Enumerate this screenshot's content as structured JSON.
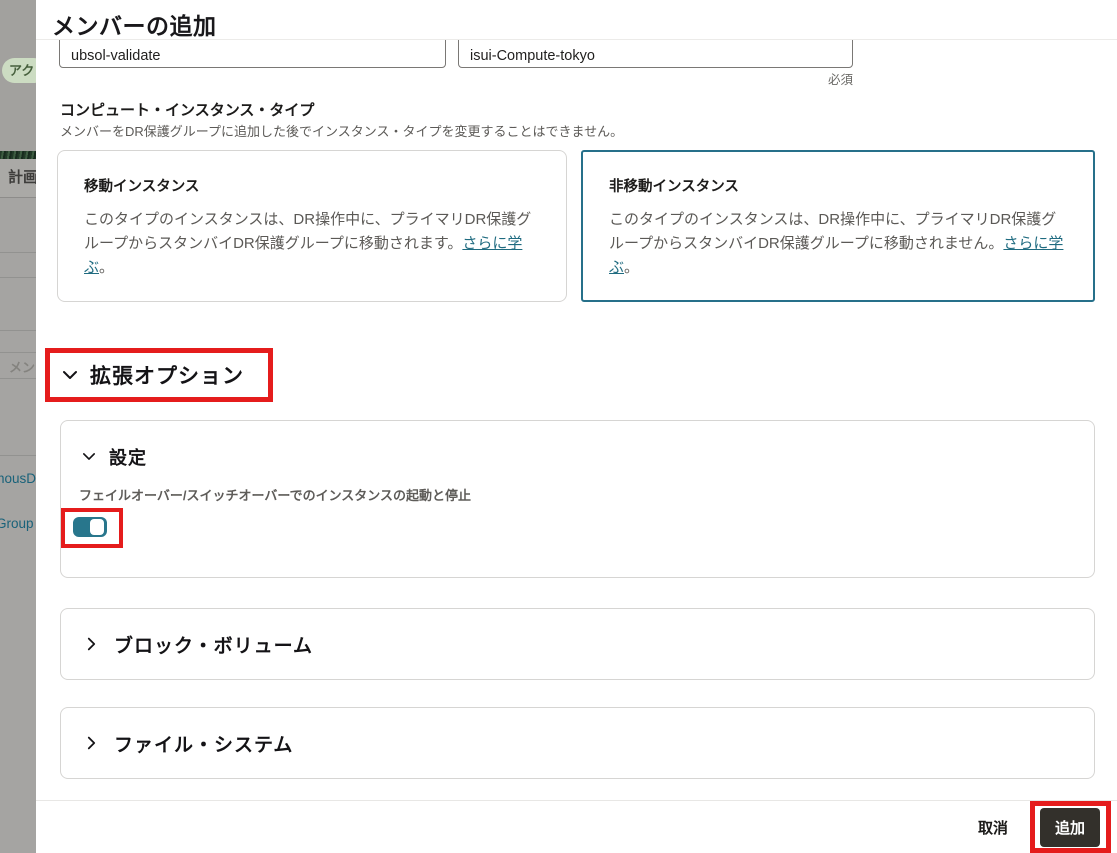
{
  "modal": {
    "title": "メンバーの追加",
    "fields": {
      "member_value": "ubsol-validate",
      "compartment_value": "isui-Compute-tokyo",
      "required_label": "必須"
    },
    "instance_type": {
      "heading": "コンピュート・インスタンス・タイプ",
      "description": "メンバーをDR保護グループに追加した後でインスタンス・タイプを変更することはできません。",
      "cards": [
        {
          "title": "移動インスタンス",
          "body": "このタイプのインスタンスは、DR操作中に、プライマリDR保護グループからスタンバイDR保護グループに移動されます。",
          "link": "さらに学ぶ",
          "period": "。"
        },
        {
          "title": "非移動インスタンス",
          "body": "このタイプのインスタンスは、DR操作中に、プライマリDR保護グループからスタンバイDR保護グループに移動されません。",
          "link": "さらに学ぶ",
          "period": "。"
        }
      ]
    },
    "advanced_options_label": "拡張オプション",
    "settings": {
      "heading": "設定",
      "toggle_label": "フェイルオーバー/スイッチオーバーでのインスタンスの起動と停止",
      "toggle_state": "on"
    },
    "block_volume_label": "ブロック・ボリューム",
    "file_system_label": "ファイル・システム",
    "footer": {
      "cancel_label": "取消",
      "add_label": "追加"
    }
  },
  "background": {
    "active_badge": "アク",
    "plan_label": "計画",
    "members_label": "メン",
    "link_autonomous": "nousD",
    "link_group": "Group"
  },
  "colors": {
    "selected_card_border": "#26708a",
    "annotation_red": "#e51c1c",
    "toggle_on": "#28768c",
    "add_button_bg": "#33302b",
    "link_teal": "#1f6b80"
  }
}
